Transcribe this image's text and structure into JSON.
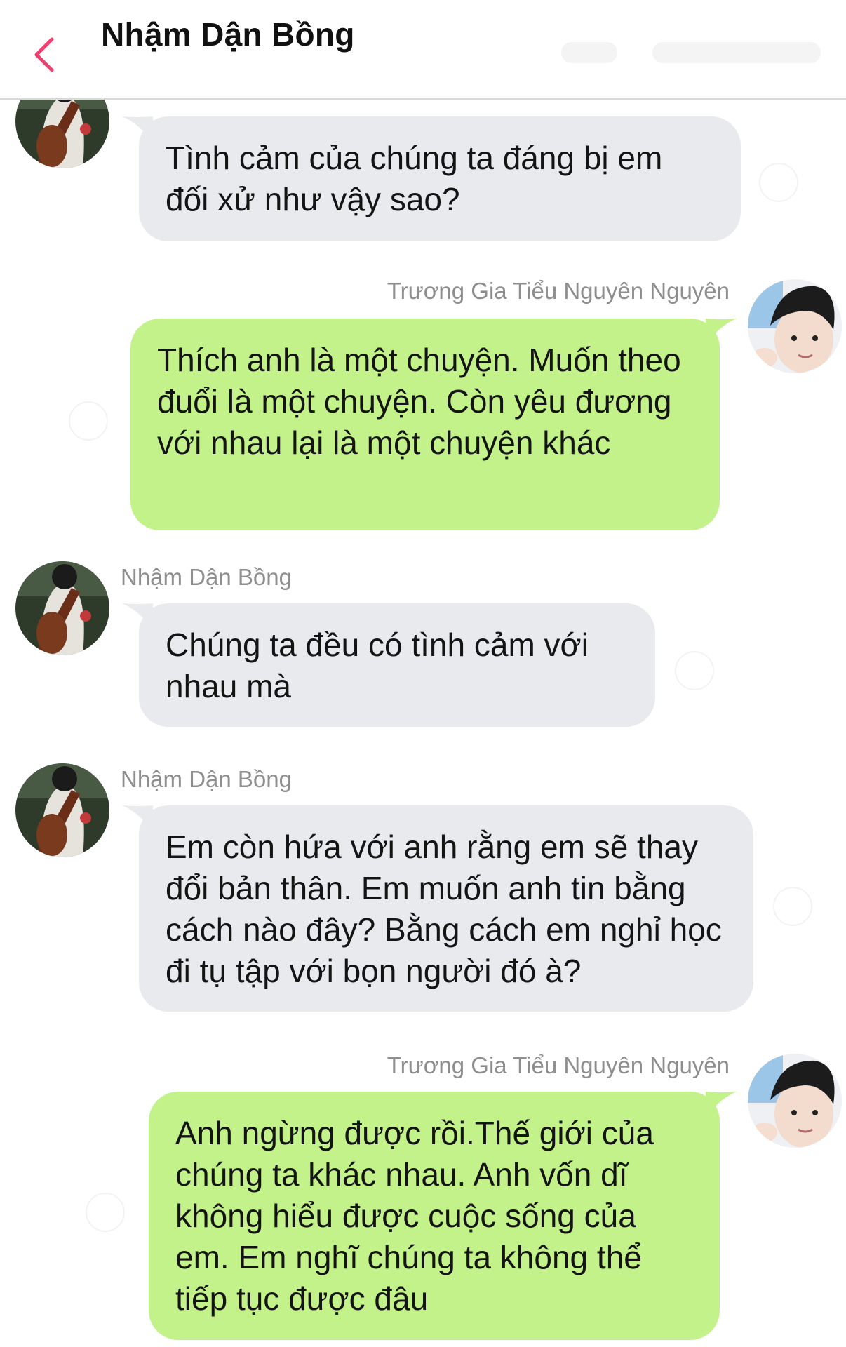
{
  "header": {
    "title": "Nhậm Dận Bồng",
    "back_icon": "chevron-left-icon",
    "accent_color": "#f0406f"
  },
  "colors": {
    "incoming_bubble": "#e8eaed",
    "outgoing_bubble": "#c4f28a",
    "name_text": "#8e8e8e"
  },
  "messages": [
    {
      "direction": "incoming",
      "sender": "",
      "text": "Tình cảm của chúng ta đáng bị em đối xử như vậy sao?",
      "avatar": "cellist-avatar"
    },
    {
      "direction": "outgoing",
      "sender": "Trương Gia Tiểu Nguyên Nguyên",
      "text": "Thích anh là một chuyện. Muốn theo đuổi là một chuyện. Còn yêu đương với nhau lại là một chuyện khác",
      "avatar": "selfie-avatar"
    },
    {
      "direction": "incoming",
      "sender": "Nhậm Dận Bồng",
      "text": "Chúng ta đều có tình cảm với nhau mà",
      "avatar": "cellist-avatar"
    },
    {
      "direction": "incoming",
      "sender": "Nhậm Dận Bồng",
      "text": "Em còn hứa với anh rằng em sẽ thay đổi bản thân. Em muốn anh tin bằng cách nào đây? Bằng cách em nghỉ học đi tụ tập với bọn người đó à?",
      "avatar": "cellist-avatar"
    },
    {
      "direction": "outgoing",
      "sender": "Trương Gia Tiểu Nguyên Nguyên",
      "text": "Anh ngừng được rồi.Thế giới của chúng ta khác nhau. Anh vốn dĩ không hiểu được cuộc sống của em. Em nghĩ chúng ta không thể tiếp tục được đâu",
      "avatar": "selfie-avatar"
    }
  ]
}
